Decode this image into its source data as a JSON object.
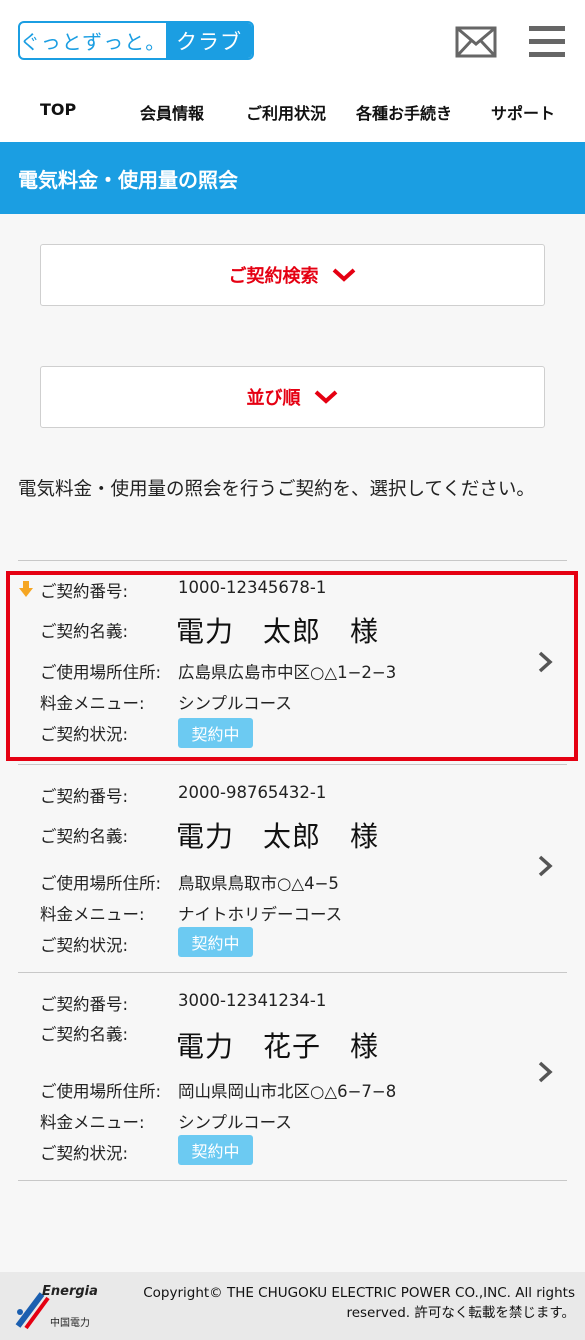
{
  "header": {
    "logo_left": "ぐっとずっと。",
    "logo_right": "クラブ",
    "mail_icon": "mail-icon",
    "menu_icon": "hamburger-menu-icon"
  },
  "nav": {
    "items": [
      {
        "label": "TOP"
      },
      {
        "label": "会員情報"
      },
      {
        "label": "ご利用状況"
      },
      {
        "label": "各種お手続き"
      },
      {
        "label": "サポート"
      }
    ]
  },
  "page_title": "電気料金・使用量の照会",
  "search_toggle": "ご契約検索",
  "sort_toggle": "並び順",
  "instruction": "電気料金・使用量の照会を行うご契約を、選択してください。",
  "labels": {
    "contract_number": "ご契約番号:",
    "contract_name": "ご契約名義:",
    "address": "ご使用場所住所:",
    "menu": "料金メニュー:",
    "status": "ご契約状況:"
  },
  "contracts": [
    {
      "number": "1000-12345678-1",
      "name": "電力　太郎　様",
      "address": "広島県広島市中区○△1−2−3",
      "menu": "シンプルコース",
      "status": "契約中",
      "selected": true
    },
    {
      "number": "2000-98765432-1",
      "name": "電力　太郎　様",
      "address": "鳥取県鳥取市○△4−5",
      "menu": "ナイトホリデーコース",
      "status": "契約中",
      "selected": false
    },
    {
      "number": "3000-12341234-1",
      "name": "電力　花子　様",
      "address": "岡山県岡山市北区○△6−7−8",
      "menu": "シンプルコース",
      "status": "契約中",
      "selected": false
    }
  ],
  "footer": {
    "brand": "Energia",
    "brand_sub": "中国電力",
    "copyright": "Copyright© THE CHUGOKU ELECTRIC POWER CO.,INC. All rights reserved. 許可なく転載を禁じます。"
  },
  "colors": {
    "accent": "#1b9ee2",
    "alert": "#e50012",
    "badge": "#6ccaf2"
  }
}
